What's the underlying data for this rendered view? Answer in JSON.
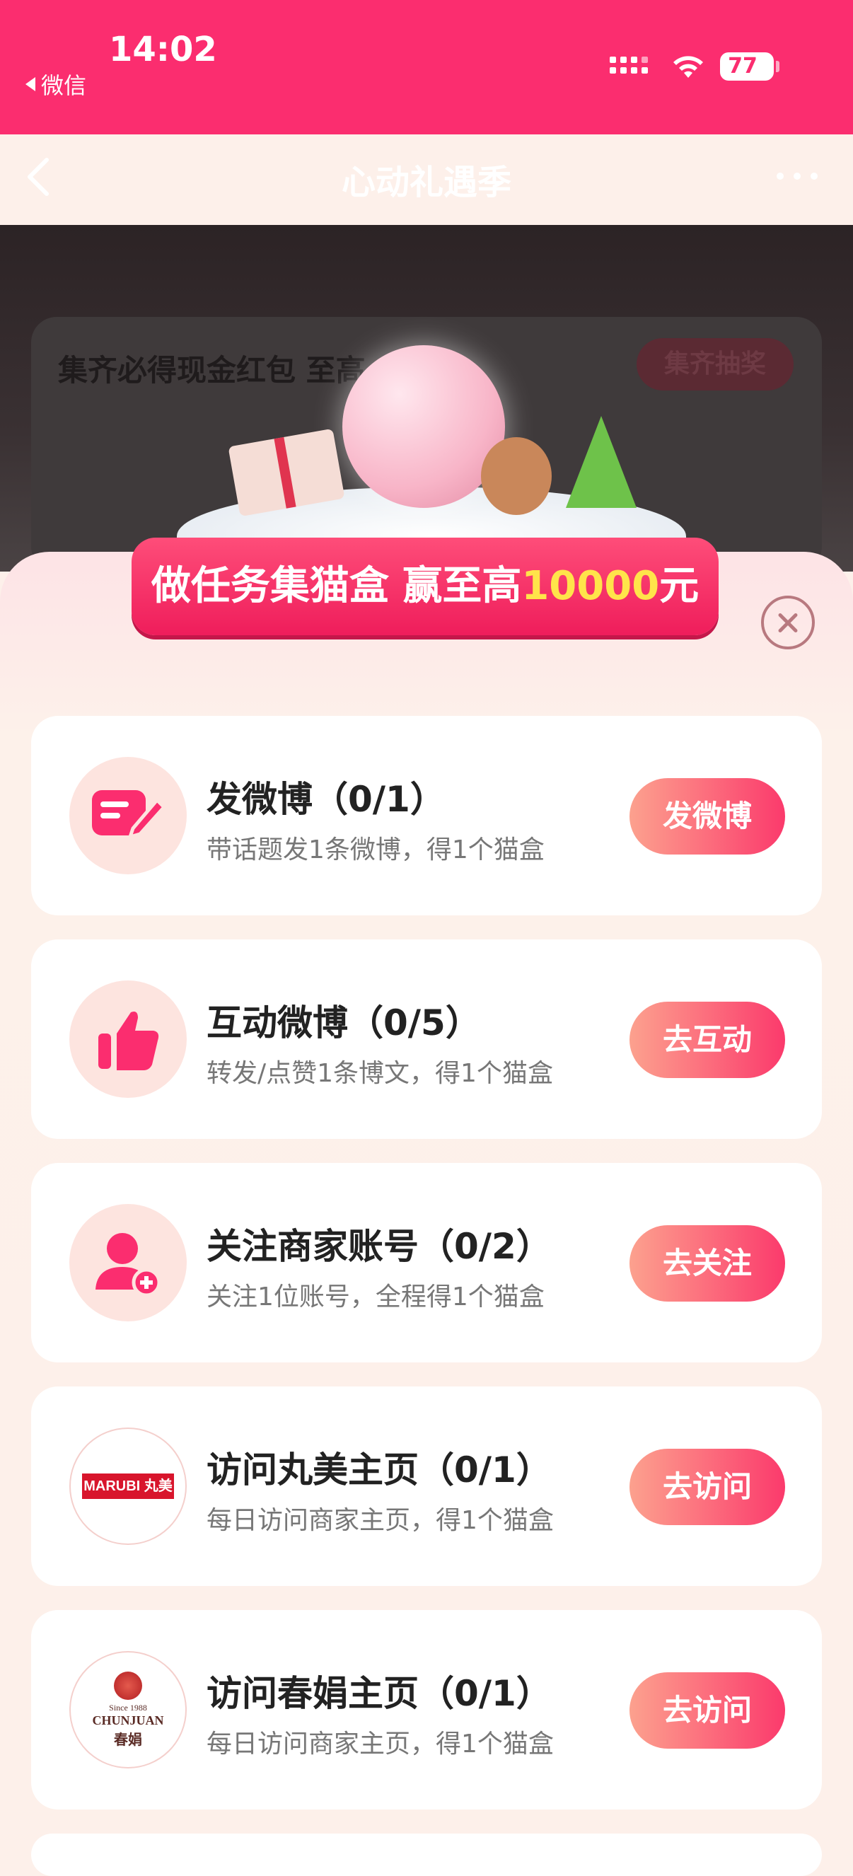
{
  "status_bar": {
    "time": "14:02",
    "back_app": "微信",
    "battery": "77"
  },
  "navbar": {
    "title": "心动礼遇季"
  },
  "hero": {
    "text": "集齐必得现金红包 至高",
    "button": "集齐抽奖"
  },
  "banner": {
    "prefix": "做任务集猫盒 赢至高",
    "highlight": "10000",
    "suffix": "元"
  },
  "tasks": [
    {
      "title": "发微博（0/1）",
      "desc": "带话题发1条微博，得1个猫盒",
      "action": "发微博",
      "icon": "edit-note-icon"
    },
    {
      "title": "互动微博（0/5）",
      "desc": "转发/点赞1条博文，得1个猫盒",
      "action": "去互动",
      "icon": "thumbs-up-icon"
    },
    {
      "title": "关注商家账号（0/2）",
      "desc": "关注1位账号，全程得1个猫盒",
      "action": "去关注",
      "icon": "add-user-icon"
    },
    {
      "title": "访问丸美主页（0/1）",
      "desc": "每日访问商家主页，得1个猫盒",
      "action": "去访问",
      "icon": "marubi-logo",
      "logo_text": "MARUBI 丸美"
    },
    {
      "title": "访问春娟主页（0/1）",
      "desc": "每日访问商家主页，得1个猫盒",
      "action": "去访问",
      "icon": "chunjuan-logo",
      "logo_small": "Since 1988",
      "logo_en": "CHUNJUAN",
      "logo_cn": "春娟"
    }
  ],
  "colors": {
    "brand": "#fb2d6f",
    "accent_yellow": "#ffe44a"
  }
}
